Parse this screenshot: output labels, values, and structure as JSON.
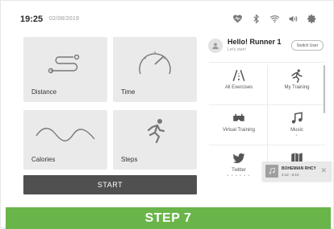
{
  "status_bar": {
    "time": "19:25",
    "date": "02/08/2019",
    "icons": [
      "heart-rate-icon",
      "bluetooth-icon",
      "wifi-icon",
      "volume-icon",
      "settings-icon"
    ]
  },
  "tiles": {
    "distance": "Distance",
    "time": "Time",
    "calories": "Calories",
    "steps": "Steps"
  },
  "start_label": "START",
  "profile": {
    "greeting": "Hello! Runner 1",
    "subtitle": "Let's start!",
    "switch_user": "Switch User"
  },
  "apps": {
    "all_exercises": "All Exercises",
    "my_training": "My Training",
    "virtual_training": "Virtual Training",
    "music": "Music",
    "twitter": "Twitter"
  },
  "now_playing": {
    "title": "BOHEMIAN RHCY",
    "time": "4:12 - 6:10"
  },
  "footer": {
    "step_label": "STEP 7"
  },
  "colors": {
    "accent_green": "#6ab54a",
    "start_button": "#505050",
    "tile_bg": "#eaeaea"
  }
}
